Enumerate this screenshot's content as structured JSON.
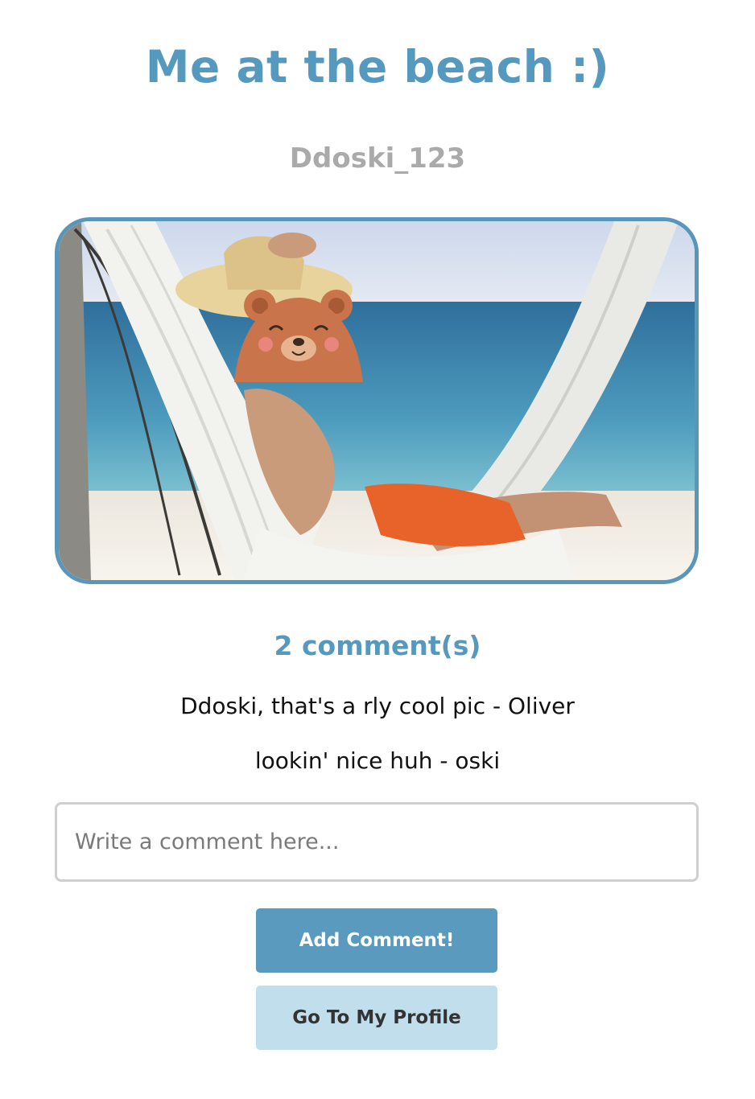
{
  "post": {
    "title": "Me at the beach :)",
    "author": "Ddoski_123",
    "image_description_icon": "beach-hammock-photo"
  },
  "comments": {
    "count_label": "2 comment(s)",
    "items": [
      "Ddoski, that's a rly cool pic - Oliver",
      "lookin' nice huh - oski"
    ]
  },
  "comment_form": {
    "placeholder": "Write a comment here...",
    "value": "",
    "submit_label": "Add Comment!"
  },
  "navigation": {
    "profile_label": "Go To My Profile"
  },
  "colors": {
    "accent": "#5599bf",
    "muted_text": "#aaaaaa",
    "button_primary": "#5a9abf",
    "button_secondary": "#c1deed"
  }
}
